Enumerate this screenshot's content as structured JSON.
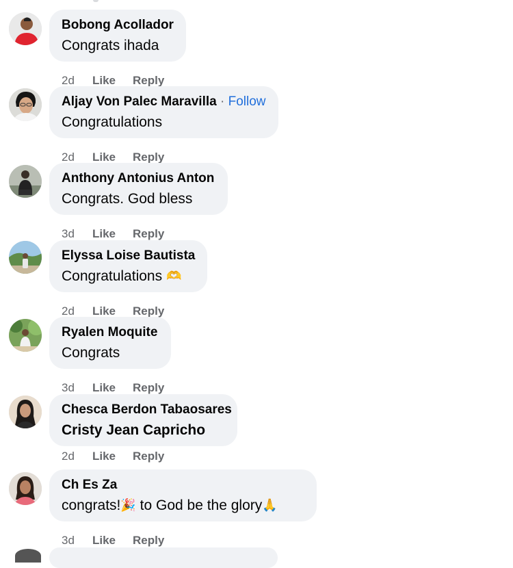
{
  "actions": {
    "like": "Like",
    "reply": "Reply"
  },
  "comments": [
    {
      "author": "Bobong Acollador",
      "follow": "",
      "text": "Congrats ihada",
      "emoji_after": "",
      "time": "2d",
      "avatar": "man-red-shirt"
    },
    {
      "author": "Aljay Von Palec Maravilla",
      "follow": "Follow",
      "text": "Congratulations",
      "emoji_after": "",
      "time": "2d",
      "avatar": "man-glasses"
    },
    {
      "author": "Anthony Antonius Anton",
      "follow": "",
      "text": "Congrats. God bless",
      "emoji_after": "",
      "time": "3d",
      "avatar": "man-sitting-dark"
    },
    {
      "author": "Elyssa Loise Bautista",
      "follow": "",
      "text": "Congratulations",
      "emoji_after": "🫶",
      "time": "2d",
      "avatar": "person-outdoor-sky"
    },
    {
      "author": "Ryalen Moquite",
      "follow": "",
      "text": "Congrats",
      "emoji_after": "",
      "time": "3d",
      "avatar": "person-green-garden"
    },
    {
      "author": "Chesca Berdon Tabaosares",
      "follow": "",
      "text": "Cristy Jean Capricho",
      "emoji_after": "",
      "time": "2d",
      "avatar": "woman-long-dark-hair"
    },
    {
      "author": "Ch Es Za",
      "follow": "",
      "text_parts": [
        "congrats!",
        "🎉",
        " to God be the glory",
        "🙏"
      ],
      "time": "3d",
      "avatar": "woman-pink-top"
    }
  ],
  "colors": {
    "bubble": "#f0f2f5",
    "meta": "#65676b",
    "link": "#216fdb",
    "text": "#050505"
  }
}
